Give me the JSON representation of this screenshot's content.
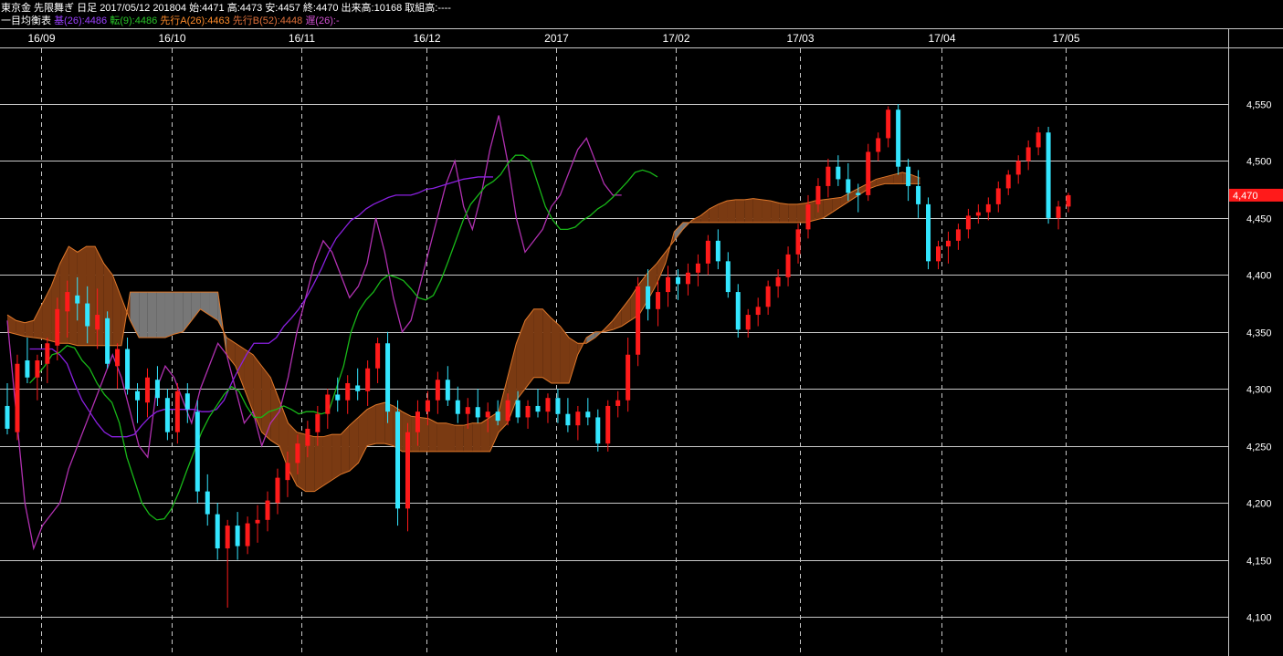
{
  "header": {
    "row1": {
      "symbol": "東京金 先限舞ぎ 日足",
      "date": "2017/05/12",
      "code": "201804",
      "open_label": "始:",
      "open": "4471",
      "high_label": "高:",
      "high": "4473",
      "low_label": "安:",
      "low": "4457",
      "close_label": "終:",
      "close": "4470",
      "volume_label": "出来高:",
      "volume": "10168",
      "oi_label": "取組高:",
      "oi": "----"
    },
    "row2": {
      "indicator": "一目均衡表",
      "kijun_label": "基(26):",
      "kijun": "4486",
      "tenkan_label": "転(9):",
      "tenkan": "4486",
      "senkoA_label": "先行A(26):",
      "senkoA": "4463",
      "senkoB_label": "先行B(52):",
      "senkoB": "4448",
      "chikou_label": "遅(26):",
      "chikou": "-"
    }
  },
  "colors": {
    "background": "#000000",
    "grid": "#c8c8c8",
    "up_candle": "#ff1a1a",
    "down_candle": "#33e6ff",
    "doji": "#ffe066",
    "cloud_bull": "#7a3a12",
    "cloud_bull_edge": "#e0782a",
    "cloud_bear": "#777777",
    "tenkan": "#18b818",
    "kijun": "#8a20e0",
    "chikou": "#b030b0",
    "senkoA": "#ff7f2a",
    "senkoB": "#ff7f2a",
    "last_price_bg": "#ff1a1a",
    "header_kijun": "#9b40ff",
    "header_tenkan": "#29c429",
    "header_senkoA": "#ff8c2a",
    "header_senkoB": "#e0703a",
    "header_chikou": "#d050d0"
  },
  "chart_data": {
    "type": "candlestick",
    "title": "東京金 先限舞ぎ 日足",
    "ylim": [
      4080,
      4590
    ],
    "y_ticks": [
      4100,
      4150,
      4200,
      4250,
      4300,
      4350,
      4400,
      4450,
      4500,
      4550
    ],
    "y_tick_labels": [
      "4,100",
      "4,150",
      "4,200",
      "4,250",
      "4,300",
      "4,350",
      "4,400",
      "4,450",
      "4,500",
      "4,550"
    ],
    "x_ticks": [
      {
        "label": "16/09",
        "bar": 6
      },
      {
        "label": "16/10",
        "bar": 29
      },
      {
        "label": "16/11",
        "bar": 52
      },
      {
        "label": "16/12",
        "bar": 74
      },
      {
        "label": "2017",
        "bar": 97
      },
      {
        "label": "17/02",
        "bar": 118
      },
      {
        "label": "17/03",
        "bar": 140
      },
      {
        "label": "17/04",
        "bar": 165
      },
      {
        "label": "17/05",
        "bar": 187
      }
    ],
    "last_price": 4470,
    "last_price_label": "4,470",
    "candles": [
      [
        4285,
        4305,
        4260,
        4265
      ],
      [
        4262,
        4330,
        4255,
        4322
      ],
      [
        4325,
        4345,
        4305,
        4310
      ],
      [
        4310,
        4330,
        4290,
        4325
      ],
      [
        4322,
        4345,
        4305,
        4340
      ],
      [
        4338,
        4380,
        4325,
        4370
      ],
      [
        4368,
        4395,
        4345,
        4385
      ],
      [
        4382,
        4398,
        4360,
        4375
      ],
      [
        4375,
        4390,
        4340,
        4355
      ],
      [
        4352,
        4388,
        4335,
        4365
      ],
      [
        4362,
        4368,
        4318,
        4322
      ],
      [
        4320,
        4340,
        4300,
        4335
      ],
      [
        4335,
        4345,
        4295,
        4300
      ],
      [
        4298,
        4305,
        4270,
        4290
      ],
      [
        4288,
        4318,
        4275,
        4310
      ],
      [
        4308,
        4320,
        4285,
        4292
      ],
      [
        4292,
        4300,
        4255,
        4262
      ],
      [
        4262,
        4305,
        4252,
        4298
      ],
      [
        4296,
        4305,
        4270,
        4282
      ],
      [
        4280,
        4290,
        4200,
        4210
      ],
      [
        4210,
        4225,
        4180,
        4190
      ],
      [
        4190,
        4200,
        4150,
        4160
      ],
      [
        4160,
        4185,
        4108,
        4180
      ],
      [
        4180,
        4192,
        4150,
        4162
      ],
      [
        4162,
        4188,
        4155,
        4182
      ],
      [
        4182,
        4198,
        4165,
        4185
      ],
      [
        4185,
        4210,
        4175,
        4202
      ],
      [
        4200,
        4230,
        4190,
        4222
      ],
      [
        4220,
        4245,
        4205,
        4235
      ],
      [
        4235,
        4260,
        4225,
        4252
      ],
      [
        4250,
        4272,
        4240,
        4265
      ],
      [
        4262,
        4285,
        4250,
        4278
      ],
      [
        4278,
        4300,
        4265,
        4295
      ],
      [
        4295,
        4310,
        4280,
        4290
      ],
      [
        4290,
        4312,
        4278,
        4305
      ],
      [
        4303,
        4318,
        4290,
        4298
      ],
      [
        4298,
        4325,
        4285,
        4318
      ],
      [
        4318,
        4345,
        4305,
        4340
      ],
      [
        4340,
        4350,
        4270,
        4280
      ],
      [
        4280,
        4290,
        4180,
        4195
      ],
      [
        4195,
        4270,
        4175,
        4262
      ],
      [
        4262,
        4290,
        4250,
        4280
      ],
      [
        4280,
        4298,
        4268,
        4290
      ],
      [
        4290,
        4315,
        4278,
        4308
      ],
      [
        4308,
        4320,
        4285,
        4290
      ],
      [
        4290,
        4302,
        4270,
        4278
      ],
      [
        4278,
        4292,
        4265,
        4284
      ],
      [
        4284,
        4300,
        4270,
        4275
      ],
      [
        4275,
        4288,
        4262,
        4280
      ],
      [
        4280,
        4290,
        4268,
        4272
      ],
      [
        4272,
        4296,
        4268,
        4290
      ],
      [
        4290,
        4298,
        4270,
        4275
      ],
      [
        4275,
        4290,
        4265,
        4285
      ],
      [
        4285,
        4300,
        4275,
        4280
      ],
      [
        4280,
        4296,
        4270,
        4292
      ],
      [
        4292,
        4300,
        4270,
        4278
      ],
      [
        4278,
        4292,
        4262,
        4268
      ],
      [
        4268,
        4285,
        4255,
        4280
      ],
      [
        4280,
        4292,
        4268,
        4275
      ],
      [
        4275,
        4282,
        4245,
        4252
      ],
      [
        4252,
        4290,
        4245,
        4285
      ],
      [
        4285,
        4298,
        4275,
        4290
      ],
      [
        4290,
        4345,
        4280,
        4330
      ],
      [
        4330,
        4398,
        4320,
        4390
      ],
      [
        4390,
        4405,
        4360,
        4370
      ],
      [
        4370,
        4395,
        4355,
        4385
      ],
      [
        4385,
        4408,
        4372,
        4398
      ],
      [
        4398,
        4405,
        4378,
        4392
      ],
      [
        4392,
        4410,
        4382,
        4402
      ],
      [
        4402,
        4418,
        4390,
        4410
      ],
      [
        4410,
        4435,
        4400,
        4430
      ],
      [
        4430,
        4440,
        4405,
        4412
      ],
      [
        4412,
        4420,
        4380,
        4385
      ],
      [
        4385,
        4392,
        4345,
        4352
      ],
      [
        4352,
        4370,
        4345,
        4365
      ],
      [
        4365,
        4380,
        4355,
        4372
      ],
      [
        4372,
        4395,
        4365,
        4390
      ],
      [
        4390,
        4405,
        4380,
        4398
      ],
      [
        4398,
        4425,
        4390,
        4418
      ],
      [
        4418,
        4445,
        4410,
        4440
      ],
      [
        4440,
        4470,
        4432,
        4462
      ],
      [
        4462,
        4485,
        4455,
        4478
      ],
      [
        4478,
        4502,
        4468,
        4495
      ],
      [
        4495,
        4505,
        4478,
        4484
      ],
      [
        4484,
        4498,
        4465,
        4472
      ],
      [
        4472,
        4480,
        4455,
        4470
      ],
      [
        4470,
        4515,
        4465,
        4508
      ],
      [
        4508,
        4525,
        4500,
        4520
      ],
      [
        4520,
        4548,
        4512,
        4545
      ],
      [
        4545,
        4550,
        4488,
        4495
      ],
      [
        4495,
        4502,
        4465,
        4478
      ],
      [
        4478,
        4492,
        4450,
        4462
      ],
      [
        4462,
        4468,
        4405,
        4412
      ],
      [
        4412,
        4430,
        4405,
        4425
      ],
      [
        4425,
        4438,
        4410,
        4430
      ],
      [
        4430,
        4445,
        4422,
        4440
      ],
      [
        4440,
        4458,
        4432,
        4452
      ],
      [
        4452,
        4462,
        4445,
        4455
      ],
      [
        4455,
        4468,
        4448,
        4462
      ],
      [
        4462,
        4482,
        4455,
        4476
      ],
      [
        4476,
        4492,
        4470,
        4488
      ],
      [
        4488,
        4505,
        4480,
        4500
      ],
      [
        4500,
        4518,
        4492,
        4512
      ],
      [
        4512,
        4530,
        4505,
        4525
      ],
      [
        4525,
        4530,
        4445,
        4450
      ],
      [
        4450,
        4465,
        4440,
        4460
      ],
      [
        4460,
        4472,
        4455,
        4470
      ]
    ],
    "tenkan": [
      4305,
      4312,
      4320,
      4330,
      4332,
      4338,
      4336,
      4325,
      4318,
      4305,
      4295,
      4288,
      4270,
      4240,
      4220,
      4200,
      4190,
      4185,
      4186,
      4195,
      4210,
      4228,
      4245,
      4262,
      4275,
      4285,
      4295,
      4302,
      4298,
      4285,
      4275,
      4275,
      4280,
      4282,
      4285,
      4282,
      4278,
      4280,
      4280,
      4278,
      4280,
      4300,
      4320,
      4350,
      4368,
      4378,
      4385,
      4395,
      4400,
      4398,
      4395,
      4388,
      4380,
      4378,
      4382,
      4395,
      4412,
      4430,
      4448,
      4462,
      4470,
      4478,
      4482,
      4488,
      4498,
      4505,
      4505,
      4500,
      4480,
      4460,
      4448,
      4440,
      4440,
      4442,
      4448,
      4452,
      4458,
      4462,
      4468,
      4475,
      4482,
      4490,
      4492,
      4490,
      4486
    ],
    "tenkan_start": 3,
    "kijun": [
      4335,
      4335,
      4335,
      4335,
      4330,
      4322,
      4305,
      4290,
      4280,
      4270,
      4262,
      4258,
      4258,
      4258,
      4260,
      4268,
      4275,
      4280,
      4282,
      4282,
      4282,
      4282,
      4282,
      4280,
      4280,
      4282,
      4290,
      4305,
      4318,
      4330,
      4340,
      4340,
      4340,
      4345,
      4355,
      4362,
      4370,
      4380,
      4392,
      4405,
      4420,
      4432,
      4440,
      4448,
      4452,
      4458,
      4462,
      4465,
      4468,
      4470,
      4470,
      4470,
      4472,
      4475,
      4476,
      4478,
      4480,
      4482,
      4484,
      4485,
      4486,
      4486,
      4486
    ],
    "kijun_start": 3,
    "kijun_x_scale": 1.32,
    "chikou": [
      4360,
      4280,
      4200,
      4160,
      4180,
      4190,
      4200,
      4230,
      4250,
      4270,
      4290,
      4310,
      4330,
      4310,
      4280,
      4250,
      4240,
      4300,
      4320,
      4310,
      4290,
      4270,
      4300,
      4320,
      4340,
      4330,
      4300,
      4270,
      4280,
      4250,
      4270,
      4280,
      4310,
      4350,
      4380,
      4410,
      4430,
      4420,
      4400,
      4380,
      4390,
      4410,
      4450,
      4420,
      4380,
      4350,
      4360,
      4390,
      4420,
      4450,
      4480,
      4500,
      4460,
      4440,
      4470,
      4510,
      4540,
      4500,
      4450,
      4420,
      4430,
      4440,
      4460,
      4470,
      4490,
      4510,
      4520,
      4500,
      4480,
      4470,
      4470
    ],
    "chikou_start": 0,
    "chikou_x_scale": 1.55,
    "senkoA": [
      4365,
      4360,
      4358,
      4360,
      4375,
      4390,
      4410,
      4425,
      4420,
      4425,
      4425,
      4410,
      4400,
      4380,
      4360,
      4345,
      4345,
      4345,
      4345,
      4348,
      4350,
      4360,
      4370,
      4365,
      4360,
      4345,
      4340,
      4335,
      4330,
      4320,
      4310,
      4290,
      4270,
      4262,
      4260,
      4258,
      4258,
      4260,
      4260,
      4268,
      4275,
      4282,
      4286,
      4288,
      4285,
      4280,
      4276,
      4275,
      4274,
      4270,
      4270,
      4268,
      4268,
      4270,
      4270,
      4275,
      4280,
      4310,
      4340,
      4360,
      4370,
      4370,
      4362,
      4355,
      4345,
      4340,
      4340,
      4345,
      4352,
      4360,
      4370,
      4380,
      4392,
      4402,
      4410,
      4420,
      4430,
      4440,
      4448,
      4452,
      4458,
      4462,
      4465,
      4466,
      4466,
      4467,
      4466,
      4465,
      4463,
      4462,
      4462,
      4463,
      4465,
      4466,
      4467,
      4468,
      4472,
      4476,
      4480,
      4484,
      4486,
      4488,
      4490,
      4488,
      4485
    ],
    "senkoB": [
      4350,
      4348,
      4346,
      4345,
      4344,
      4342,
      4340,
      4340,
      4338,
      4338,
      4338,
      4338,
      4338,
      4338,
      4385,
      4385,
      4385,
      4385,
      4385,
      4385,
      4385,
      4385,
      4385,
      4385,
      4385,
      4330,
      4320,
      4300,
      4280,
      4262,
      4255,
      4250,
      4230,
      4215,
      4210,
      4210,
      4215,
      4220,
      4225,
      4228,
      4235,
      4250,
      4252,
      4252,
      4250,
      4245,
      4245,
      4245,
      4245,
      4245,
      4245,
      4245,
      4245,
      4245,
      4245,
      4245,
      4262,
      4270,
      4290,
      4300,
      4310,
      4310,
      4305,
      4305,
      4305,
      4330,
      4345,
      4350,
      4350,
      4352,
      4355,
      4360,
      4365,
      4378,
      4392,
      4410,
      4438,
      4446,
      4446,
      4446,
      4446,
      4446,
      4446,
      4446,
      4446,
      4446,
      4446,
      4446,
      4446,
      4446,
      4446,
      4446,
      4448,
      4450,
      4455,
      4460,
      4465,
      4470,
      4475,
      4478,
      4480,
      4480,
      4480,
      4480,
      4480
    ],
    "cloud_x_scale": 1.55
  }
}
